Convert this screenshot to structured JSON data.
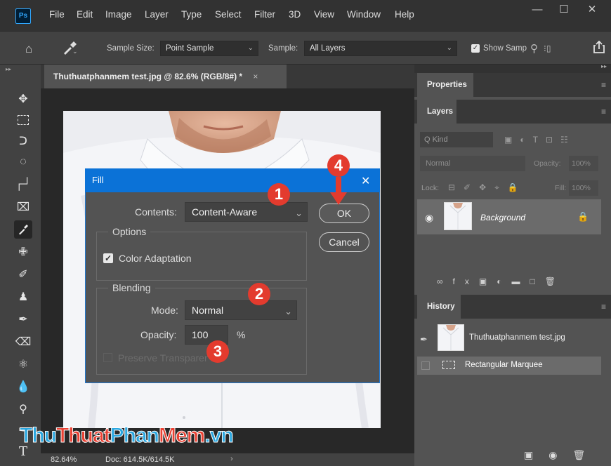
{
  "menubar": {
    "app_icon": "Ps",
    "items": [
      "File",
      "Edit",
      "Image",
      "Layer",
      "Type",
      "Select",
      "Filter",
      "3D",
      "View",
      "Window",
      "Help"
    ],
    "window_buttons": [
      "minimize-icon",
      "maximize-icon",
      "close-icon"
    ]
  },
  "options_bar": {
    "sample_size_label": "Sample Size:",
    "sample_size_value": "Point Sample",
    "sample_label": "Sample:",
    "sample_value": "All Layers",
    "show_sampling_label": "Show Samp",
    "show_sampling_checked": true
  },
  "document": {
    "tab_title": "Thuthuatphanmem test.jpg @ 82.6% (RGB/8#) *",
    "zoom": "82.64%",
    "doc_size": "Doc: 614.5K/614.5K"
  },
  "panels": {
    "properties_tab": "Properties",
    "layers_tab": "Layers",
    "layers_filter_placeholder": "Q Kind",
    "blend_mode": "Normal",
    "opacity_label": "Opacity:",
    "opacity_value": "100%",
    "lock_label": "Lock:",
    "fill_label": "Fill:",
    "fill_value": "100%",
    "layer_name": "Background",
    "history_tab": "History",
    "history_items": [
      "Thuthuatphanmem test.jpg",
      "Rectangular Marquee"
    ]
  },
  "fill_dialog": {
    "title": "Fill",
    "contents_label": "Contents:",
    "contents_value": "Content-Aware",
    "options_group": "Options",
    "color_adaptation_label": "Color Adaptation",
    "color_adaptation_checked": true,
    "blending_group": "Blending",
    "mode_label": "Mode:",
    "mode_value": "Normal",
    "opacity_label": "Opacity:",
    "opacity_value": "100",
    "opacity_unit": "%",
    "preserve_label": "Preserve Transparency",
    "ok_label": "OK",
    "cancel_label": "Cancel"
  },
  "annotations": {
    "badges": [
      "1",
      "2",
      "3",
      "4"
    ],
    "color": "#e33b2e"
  },
  "watermark": {
    "part1": "Thu",
    "part2": "Thuat",
    "part3": "Phan",
    "part4": "Mem",
    "part5": ".vn"
  }
}
